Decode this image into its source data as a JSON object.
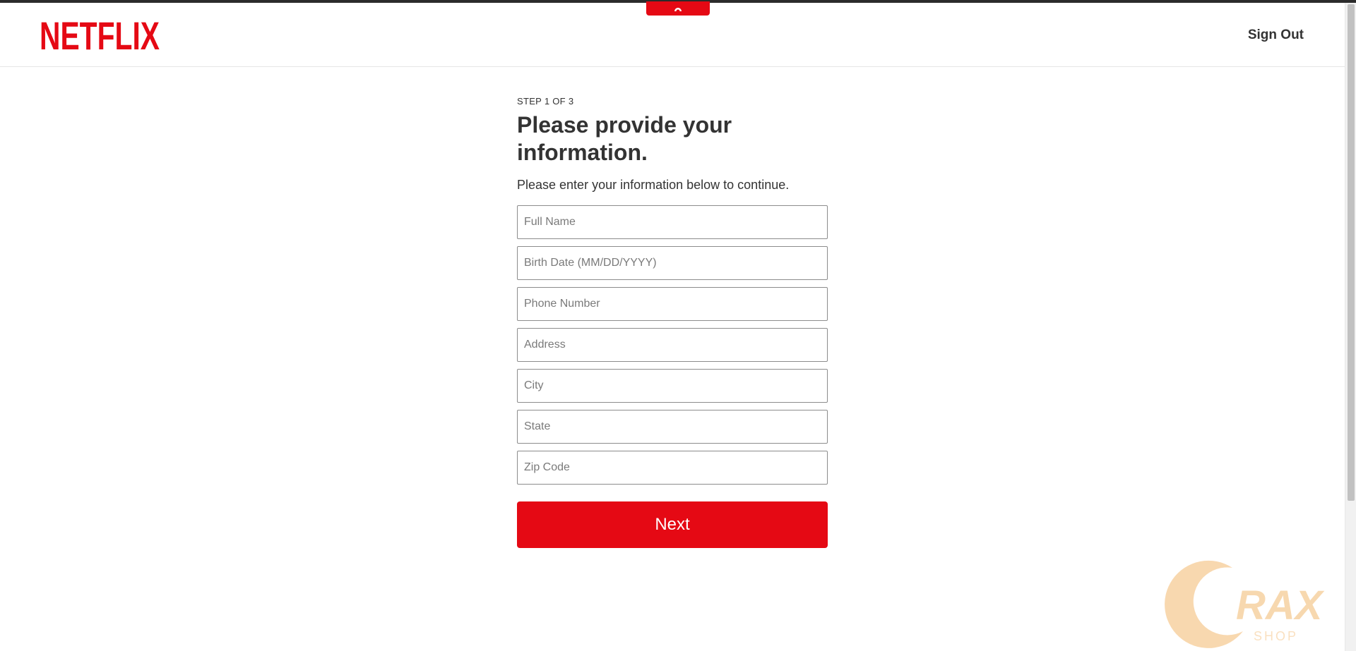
{
  "header": {
    "logo_text": "NETFLIX",
    "sign_out_label": "Sign Out"
  },
  "form": {
    "step_label": "STEP 1 OF 3",
    "title": "Please provide your information.",
    "subtitle": "Please enter your information below to continue.",
    "fields": [
      {
        "placeholder": "Full Name",
        "value": ""
      },
      {
        "placeholder": "Birth Date (MM/DD/YYYY)",
        "value": ""
      },
      {
        "placeholder": "Phone Number",
        "value": ""
      },
      {
        "placeholder": "Address",
        "value": ""
      },
      {
        "placeholder": "City",
        "value": ""
      },
      {
        "placeholder": "State",
        "value": ""
      },
      {
        "placeholder": "Zip Code",
        "value": ""
      }
    ],
    "next_label": "Next"
  },
  "watermark": {
    "text": "RAX",
    "subtext": "SHOP"
  },
  "colors": {
    "brand": "#e50914",
    "text": "#333333",
    "watermark": "#f5c68a"
  }
}
